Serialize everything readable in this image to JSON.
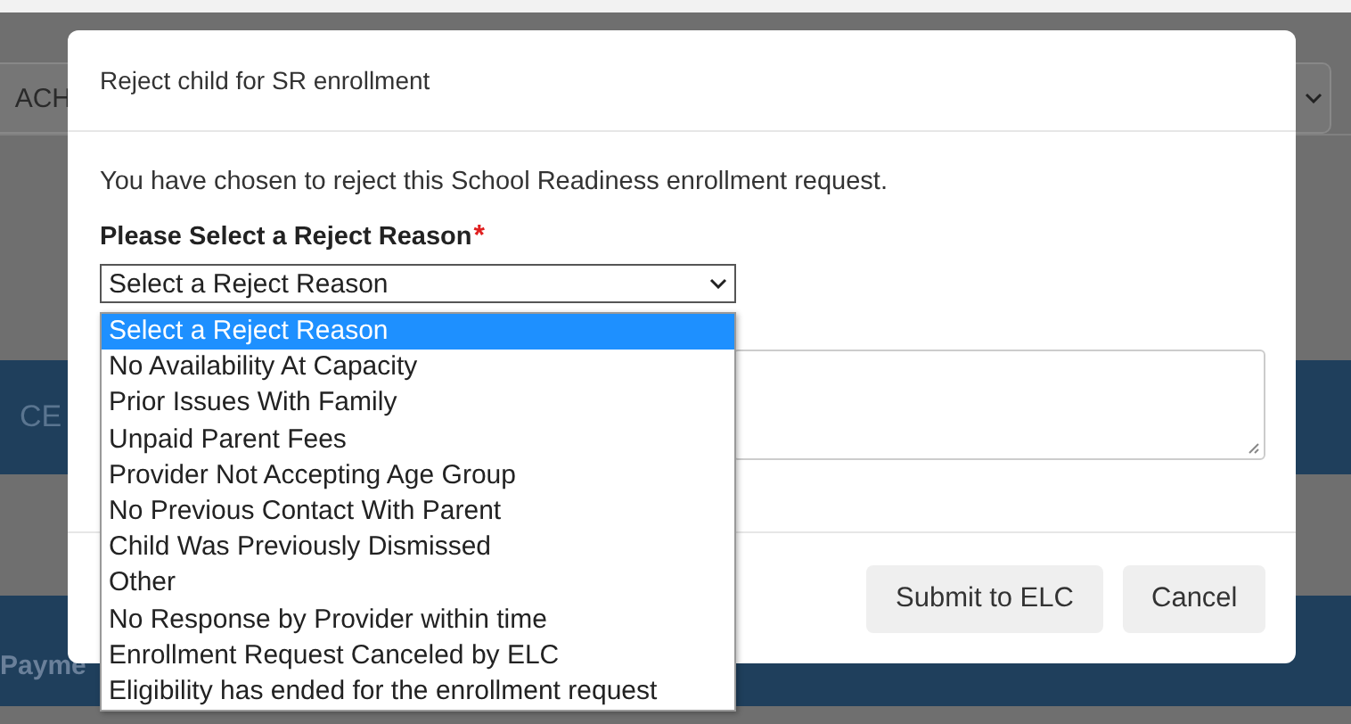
{
  "page": {
    "filter_text": "ACH",
    "band_text": "CE",
    "column_header": "Payme"
  },
  "dialog": {
    "title": "Reject child for SR enrollment",
    "message": "You have chosen to reject this School Readiness enrollment request.",
    "reason_label": "Please Select a Reject Reason",
    "required_mark": "*",
    "reason_select": {
      "value": "Select a Reject Reason",
      "expanded": true,
      "options": [
        {
          "label": "Select a Reject Reason",
          "selected": true
        },
        {
          "label": "No Availability At Capacity",
          "selected": false
        },
        {
          "label": "Prior Issues With Family",
          "selected": false
        },
        {
          "label": "Unpaid Parent Fees",
          "selected": false
        },
        {
          "label": "Provider Not Accepting Age Group",
          "selected": false
        },
        {
          "label": "No Previous Contact With Parent",
          "selected": false
        },
        {
          "label": "Child Was Previously Dismissed",
          "selected": false
        },
        {
          "label": "Other",
          "selected": false
        },
        {
          "label": "No Response by Provider within time",
          "selected": false
        },
        {
          "label": "Enrollment Request Canceled by ELC",
          "selected": false
        },
        {
          "label": "Eligibility has ended for the enrollment request",
          "selected": false
        }
      ]
    },
    "buttons": [
      "Submit to ELC",
      "Cancel"
    ]
  }
}
